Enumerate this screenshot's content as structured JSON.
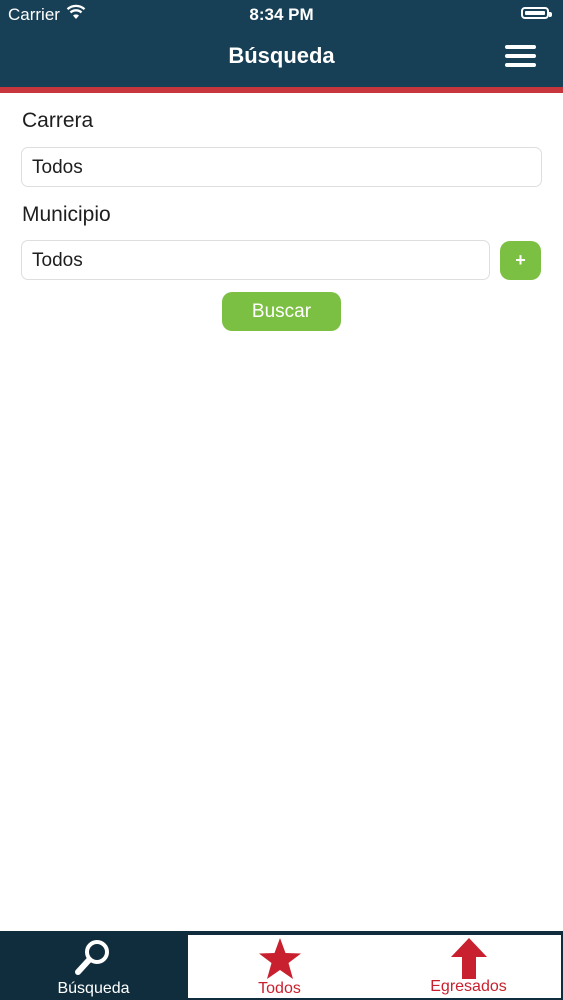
{
  "status_bar": {
    "carrier": "Carrier",
    "time": "8:34 PM",
    "icons": [
      "wifi-icon",
      "battery-icon"
    ]
  },
  "header": {
    "title": "Búsqueda",
    "menu_icon": "hamburger-menu-icon",
    "background": "#173f56",
    "accent_border": "#c8363d"
  },
  "form": {
    "carrera": {
      "label": "Carrera",
      "value": "Todos"
    },
    "municipio": {
      "label": "Municipio",
      "value": "Todos"
    },
    "add_button_label": "+",
    "search_button_label": "Buscar",
    "button_color": "#7cc043"
  },
  "tabbar": {
    "tabs": [
      {
        "label": "Búsqueda",
        "icon": "magnifier-icon",
        "active": true
      },
      {
        "label": "Todos",
        "icon": "star-icon",
        "active": false
      },
      {
        "label": "Egresados",
        "icon": "arrow-up-icon",
        "active": false
      }
    ],
    "inactive_color": "#c8202e"
  }
}
